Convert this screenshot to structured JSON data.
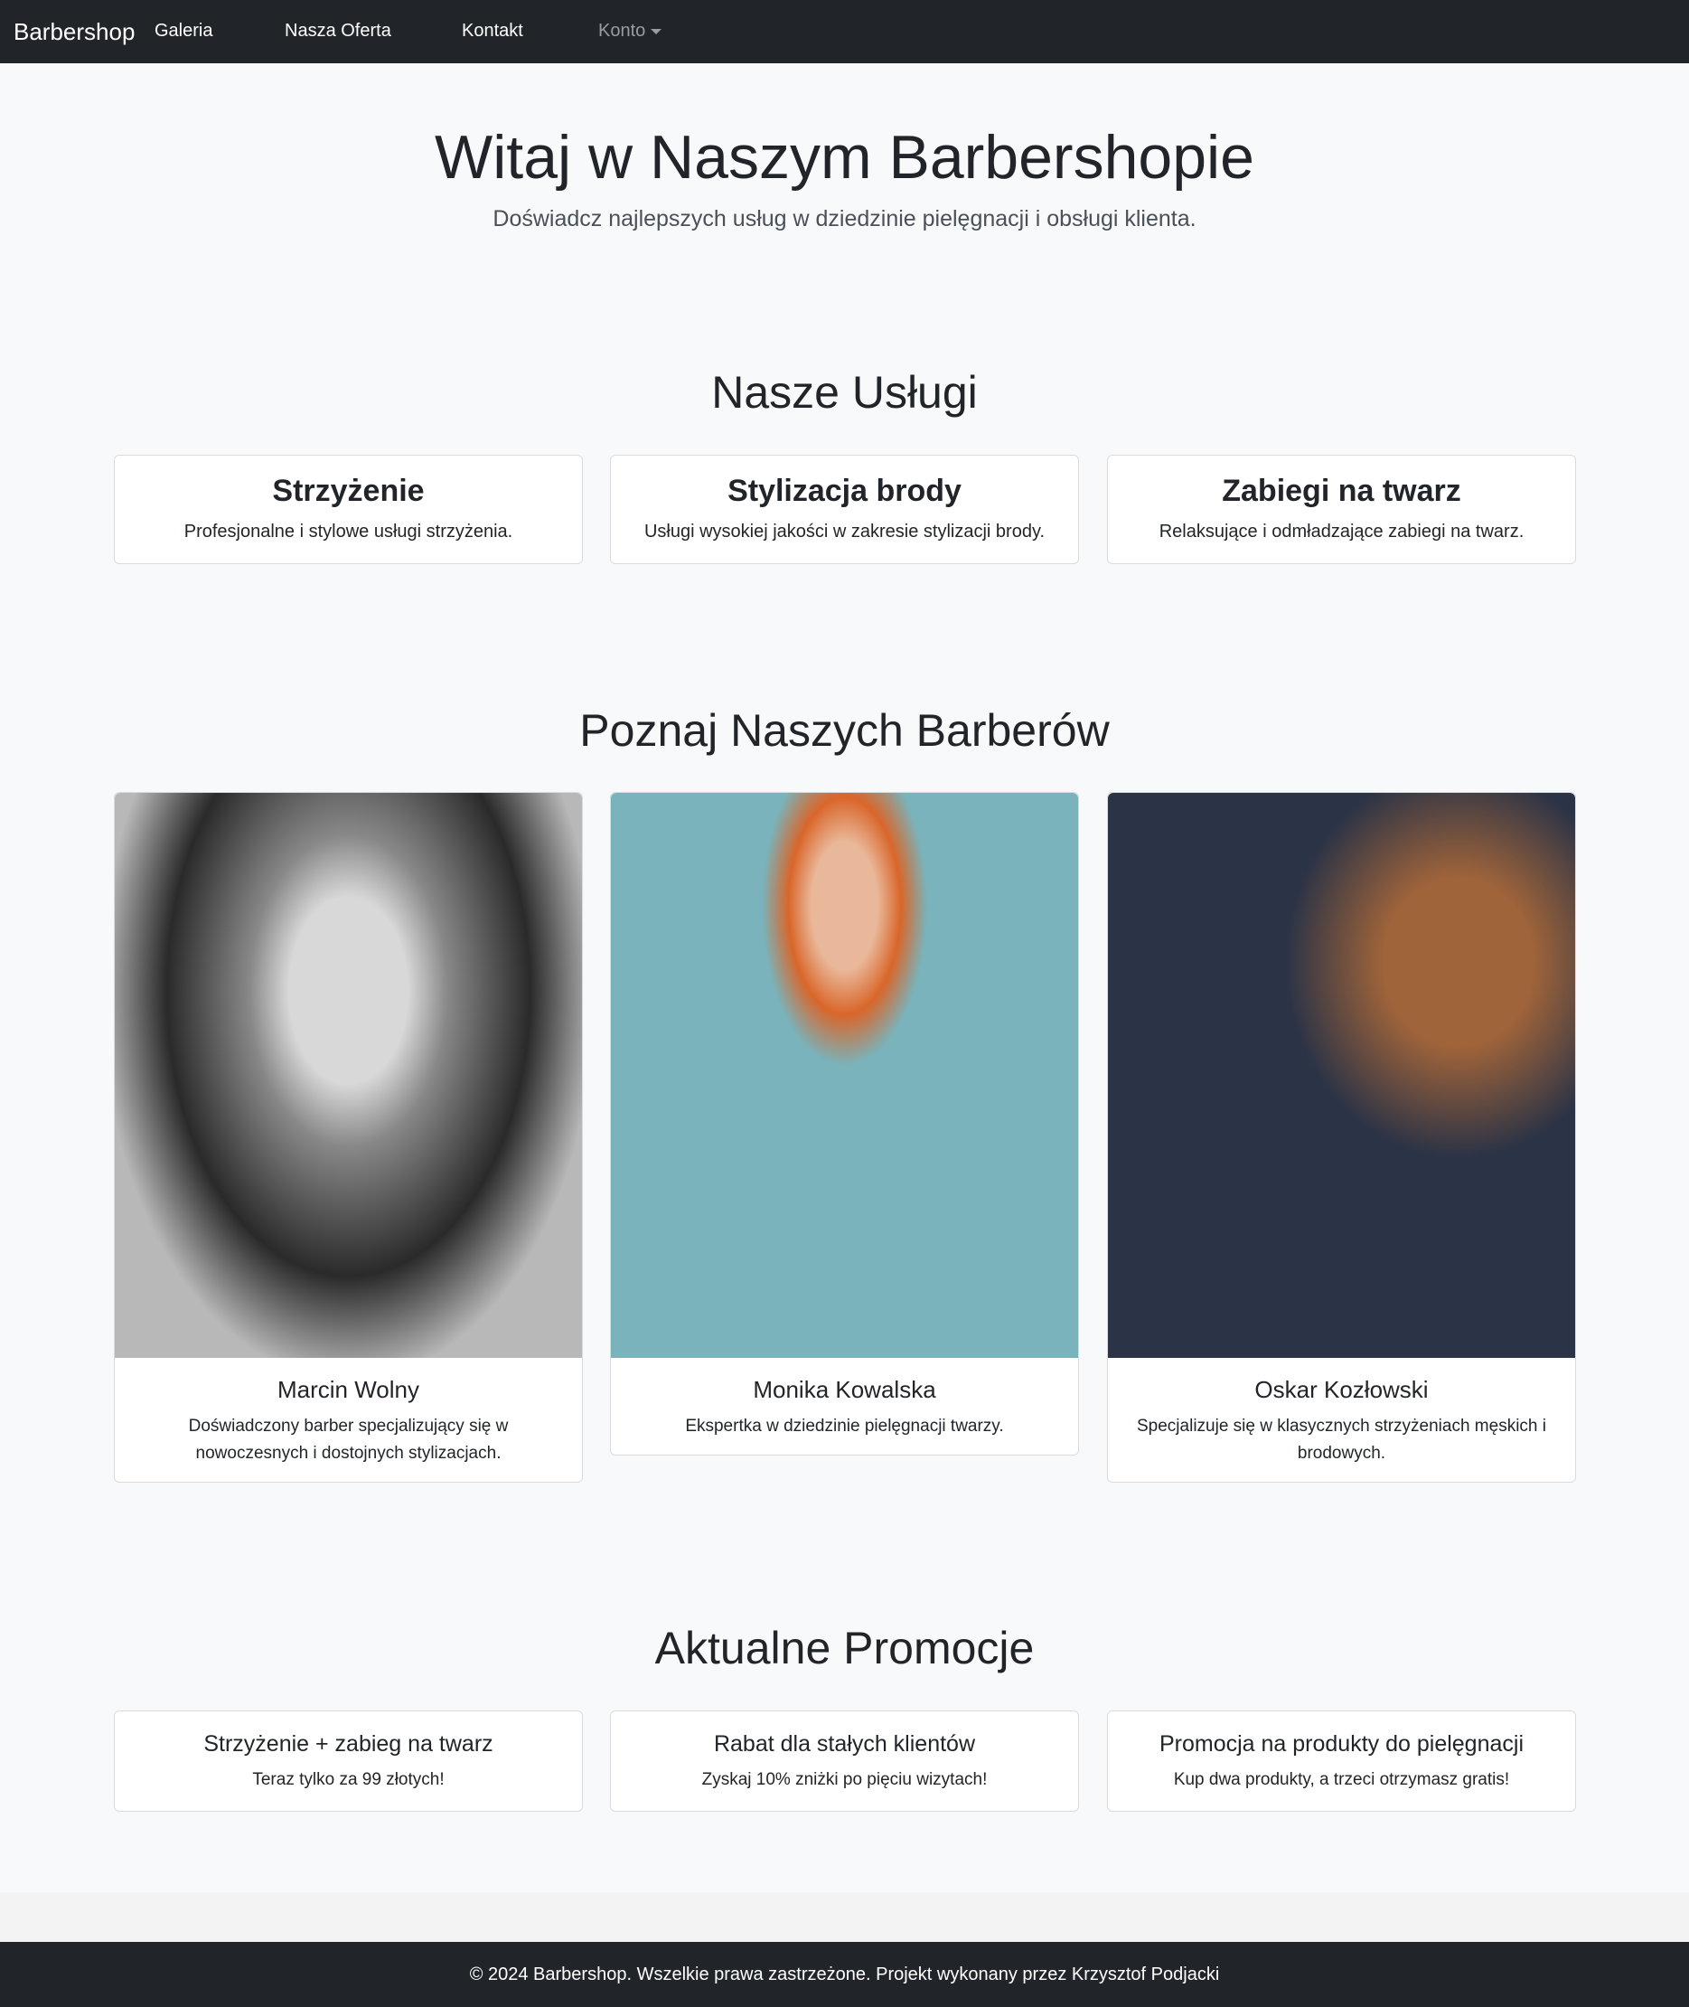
{
  "nav": {
    "brand": "Barbershop",
    "items": [
      "Galeria",
      "Nasza Oferta",
      "Kontakt"
    ],
    "account": "Konto"
  },
  "hero": {
    "title": "Witaj w Naszym Barbershopie",
    "subtitle": "Doświadcz najlepszych usług w dziedzinie pielęgnacji i obsługi klienta."
  },
  "services": {
    "heading": "Nasze Usługi",
    "items": [
      {
        "title": "Strzyżenie",
        "text": "Profesjonalne i stylowe usługi strzyżenia."
      },
      {
        "title": "Stylizacja brody",
        "text": "Usługi wysokiej jakości w zakresie stylizacji brody."
      },
      {
        "title": "Zabiegi na twarz",
        "text": "Relaksujące i odmładzające zabiegi na twarz."
      }
    ]
  },
  "barbers": {
    "heading": "Poznaj Naszych Barberów",
    "items": [
      {
        "name": "Marcin Wolny",
        "text": "Doświadczony barber specjalizujący się w nowoczesnych i dostojnych stylizacjach."
      },
      {
        "name": "Monika Kowalska",
        "text": "Ekspertka w dziedzinie pielęgnacji twarzy."
      },
      {
        "name": "Oskar Kozłowski",
        "text": "Specjalizuje się w klasycznych strzyżeniach męskich i brodowych."
      }
    ]
  },
  "promos": {
    "heading": "Aktualne Promocje",
    "items": [
      {
        "title": "Strzyżenie + zabieg na twarz",
        "text": "Teraz tylko za 99 złotych!"
      },
      {
        "title": "Rabat dla stałych klientów",
        "text": "Zyskaj 10% zniżki po pięciu wizytach!"
      },
      {
        "title": "Promocja na produkty do pielęgnacji",
        "text": "Kup dwa produkty, a trzeci otrzymasz gratis!"
      }
    ]
  },
  "footer": {
    "text": "© 2024 Barbershop. Wszelkie prawa zastrzeżone. Projekt wykonany przez Krzysztof Podjacki"
  }
}
